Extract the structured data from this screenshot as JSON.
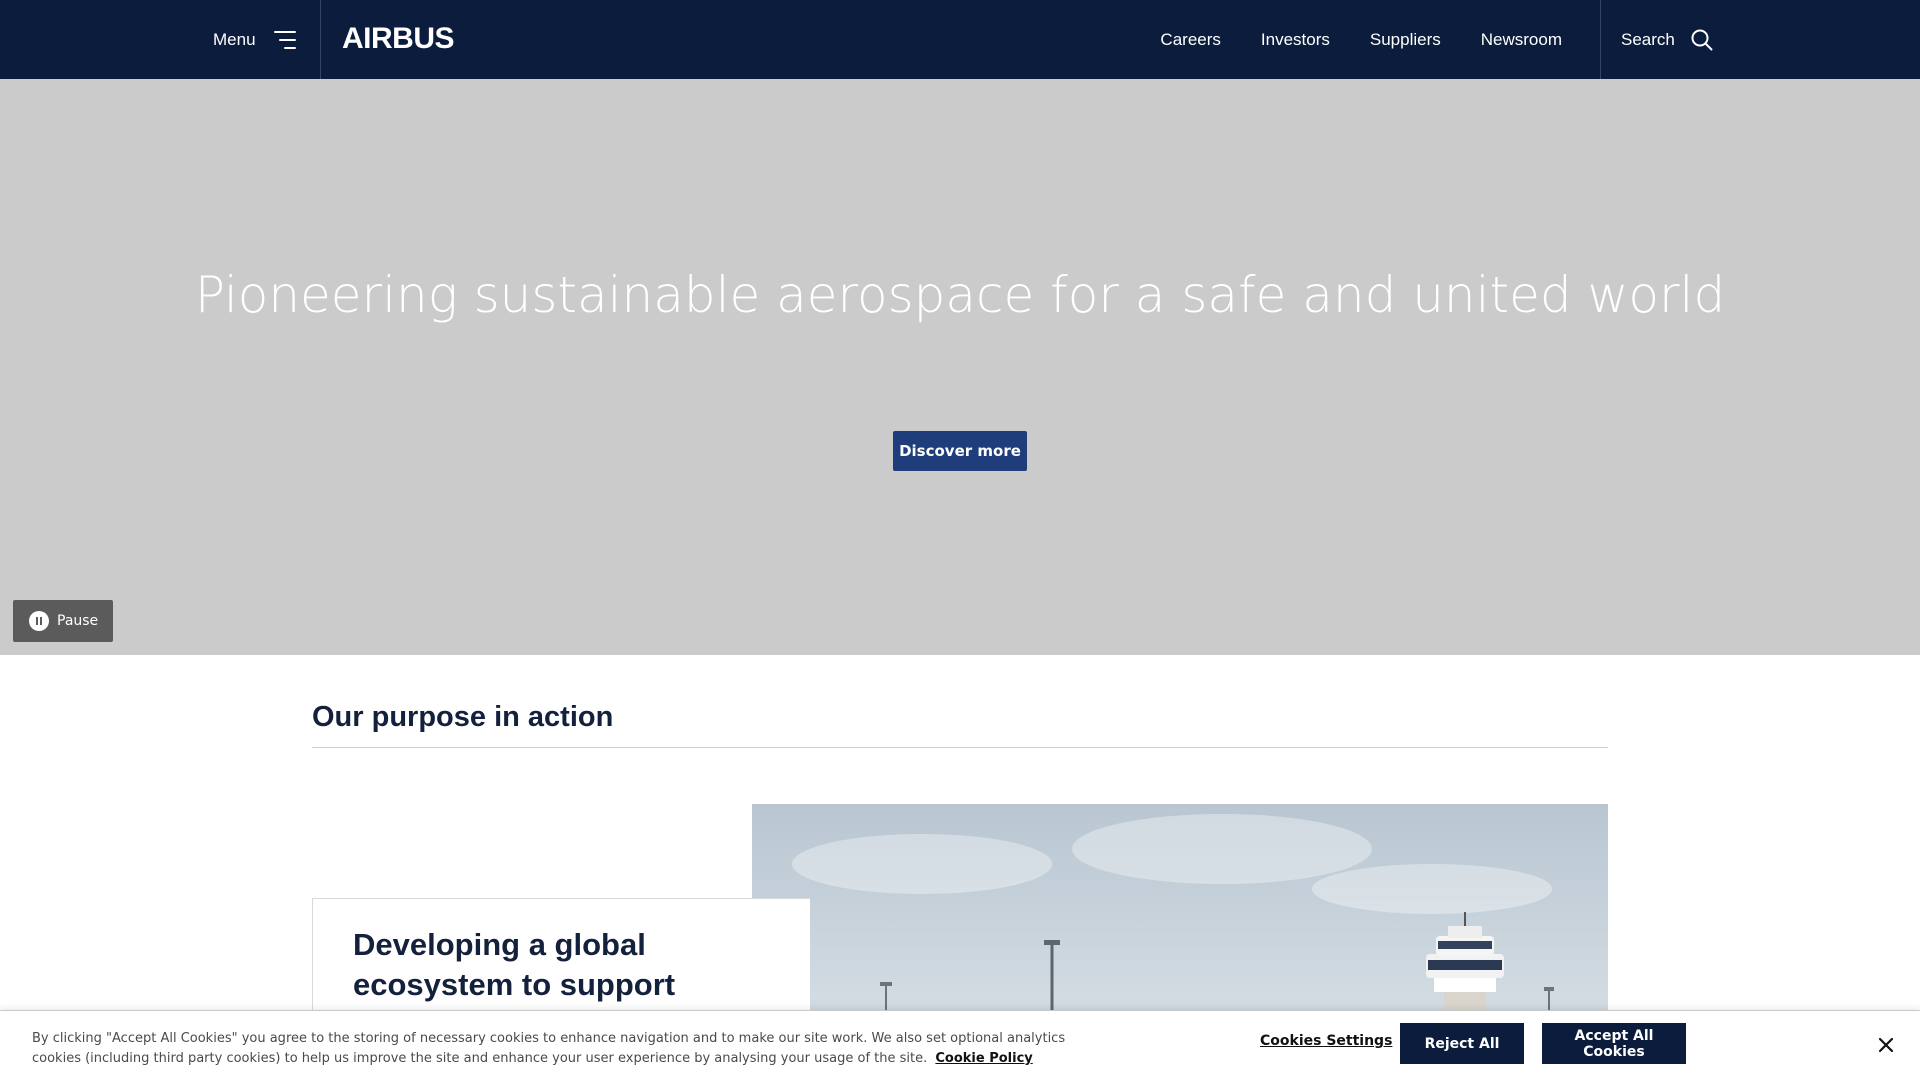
{
  "header": {
    "menu_label": "Menu",
    "logo_text": "AIRBUS",
    "nav": [
      "Careers",
      "Investors",
      "Suppliers",
      "Newsroom"
    ],
    "search_label": "Search",
    "bg_color": "#0b1c3d"
  },
  "hero": {
    "title": "Pioneering sustainable aerospace for a safe and united world",
    "cta_label": "Discover more",
    "pause_label": "Pause",
    "bg_color": "#cbcbcb",
    "cta_color": "#1f3d7b"
  },
  "purpose": {
    "section_title": "Our purpose in action",
    "card_title": "Developing a global ecosystem to support"
  },
  "cookie_banner": {
    "text": "By clicking \"Accept All Cookies\" you agree to the storing of necessary cookies to enhance navigation and to make our site work. We also set optional analytics cookies (including third party cookies) to help us improve the site and enhance your user experience by analysing your usage of the site.",
    "policy_link": "Cookie Policy",
    "settings_label": "Cookies Settings",
    "reject_label": "Reject All",
    "accept_label": "Accept All Cookies"
  }
}
